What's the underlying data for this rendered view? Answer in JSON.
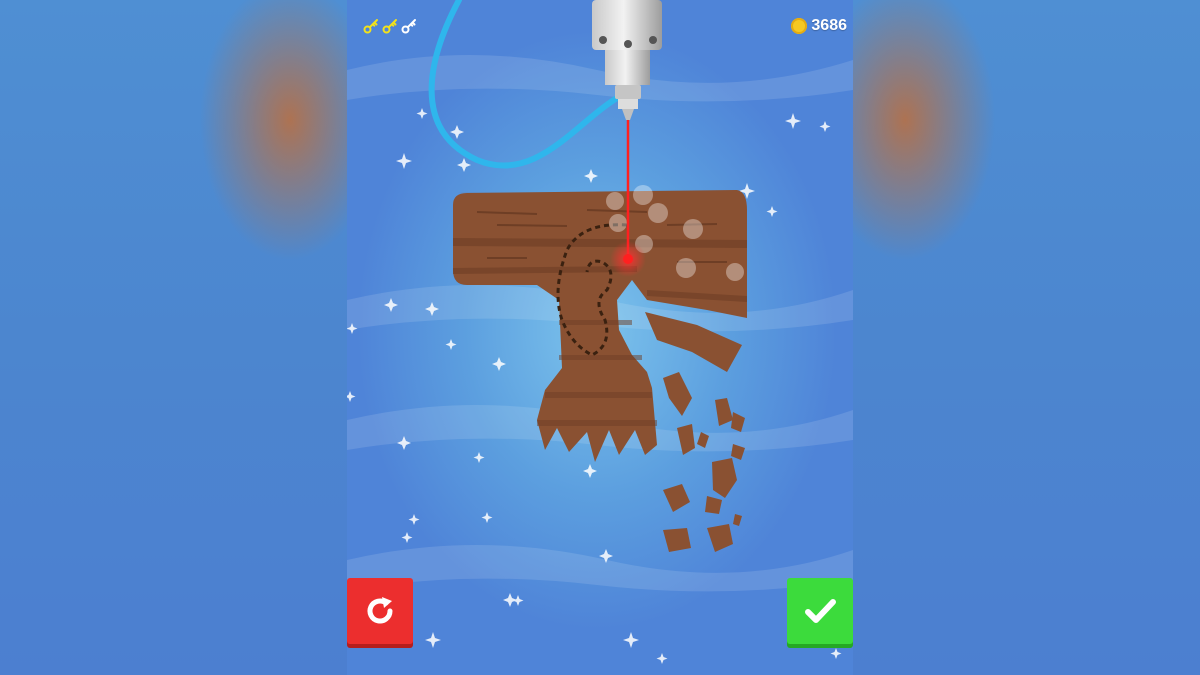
{
  "hud": {
    "keys": [
      {
        "icon": "key-icon",
        "collected": true
      },
      {
        "icon": "key-icon",
        "collected": true
      },
      {
        "icon": "key-icon",
        "collected": false
      }
    ],
    "coins": "3686",
    "coin_icon": "coin-icon"
  },
  "buttons": {
    "restart_icon": "restart-icon",
    "confirm_icon": "checkmark-icon"
  },
  "colors": {
    "key_collected": "#f2e21b",
    "key_empty": "#ffffff",
    "restart": "#ec2e2e",
    "confirm": "#3cdb3c",
    "laser": "#ff2020",
    "wood": "#8a5132"
  }
}
